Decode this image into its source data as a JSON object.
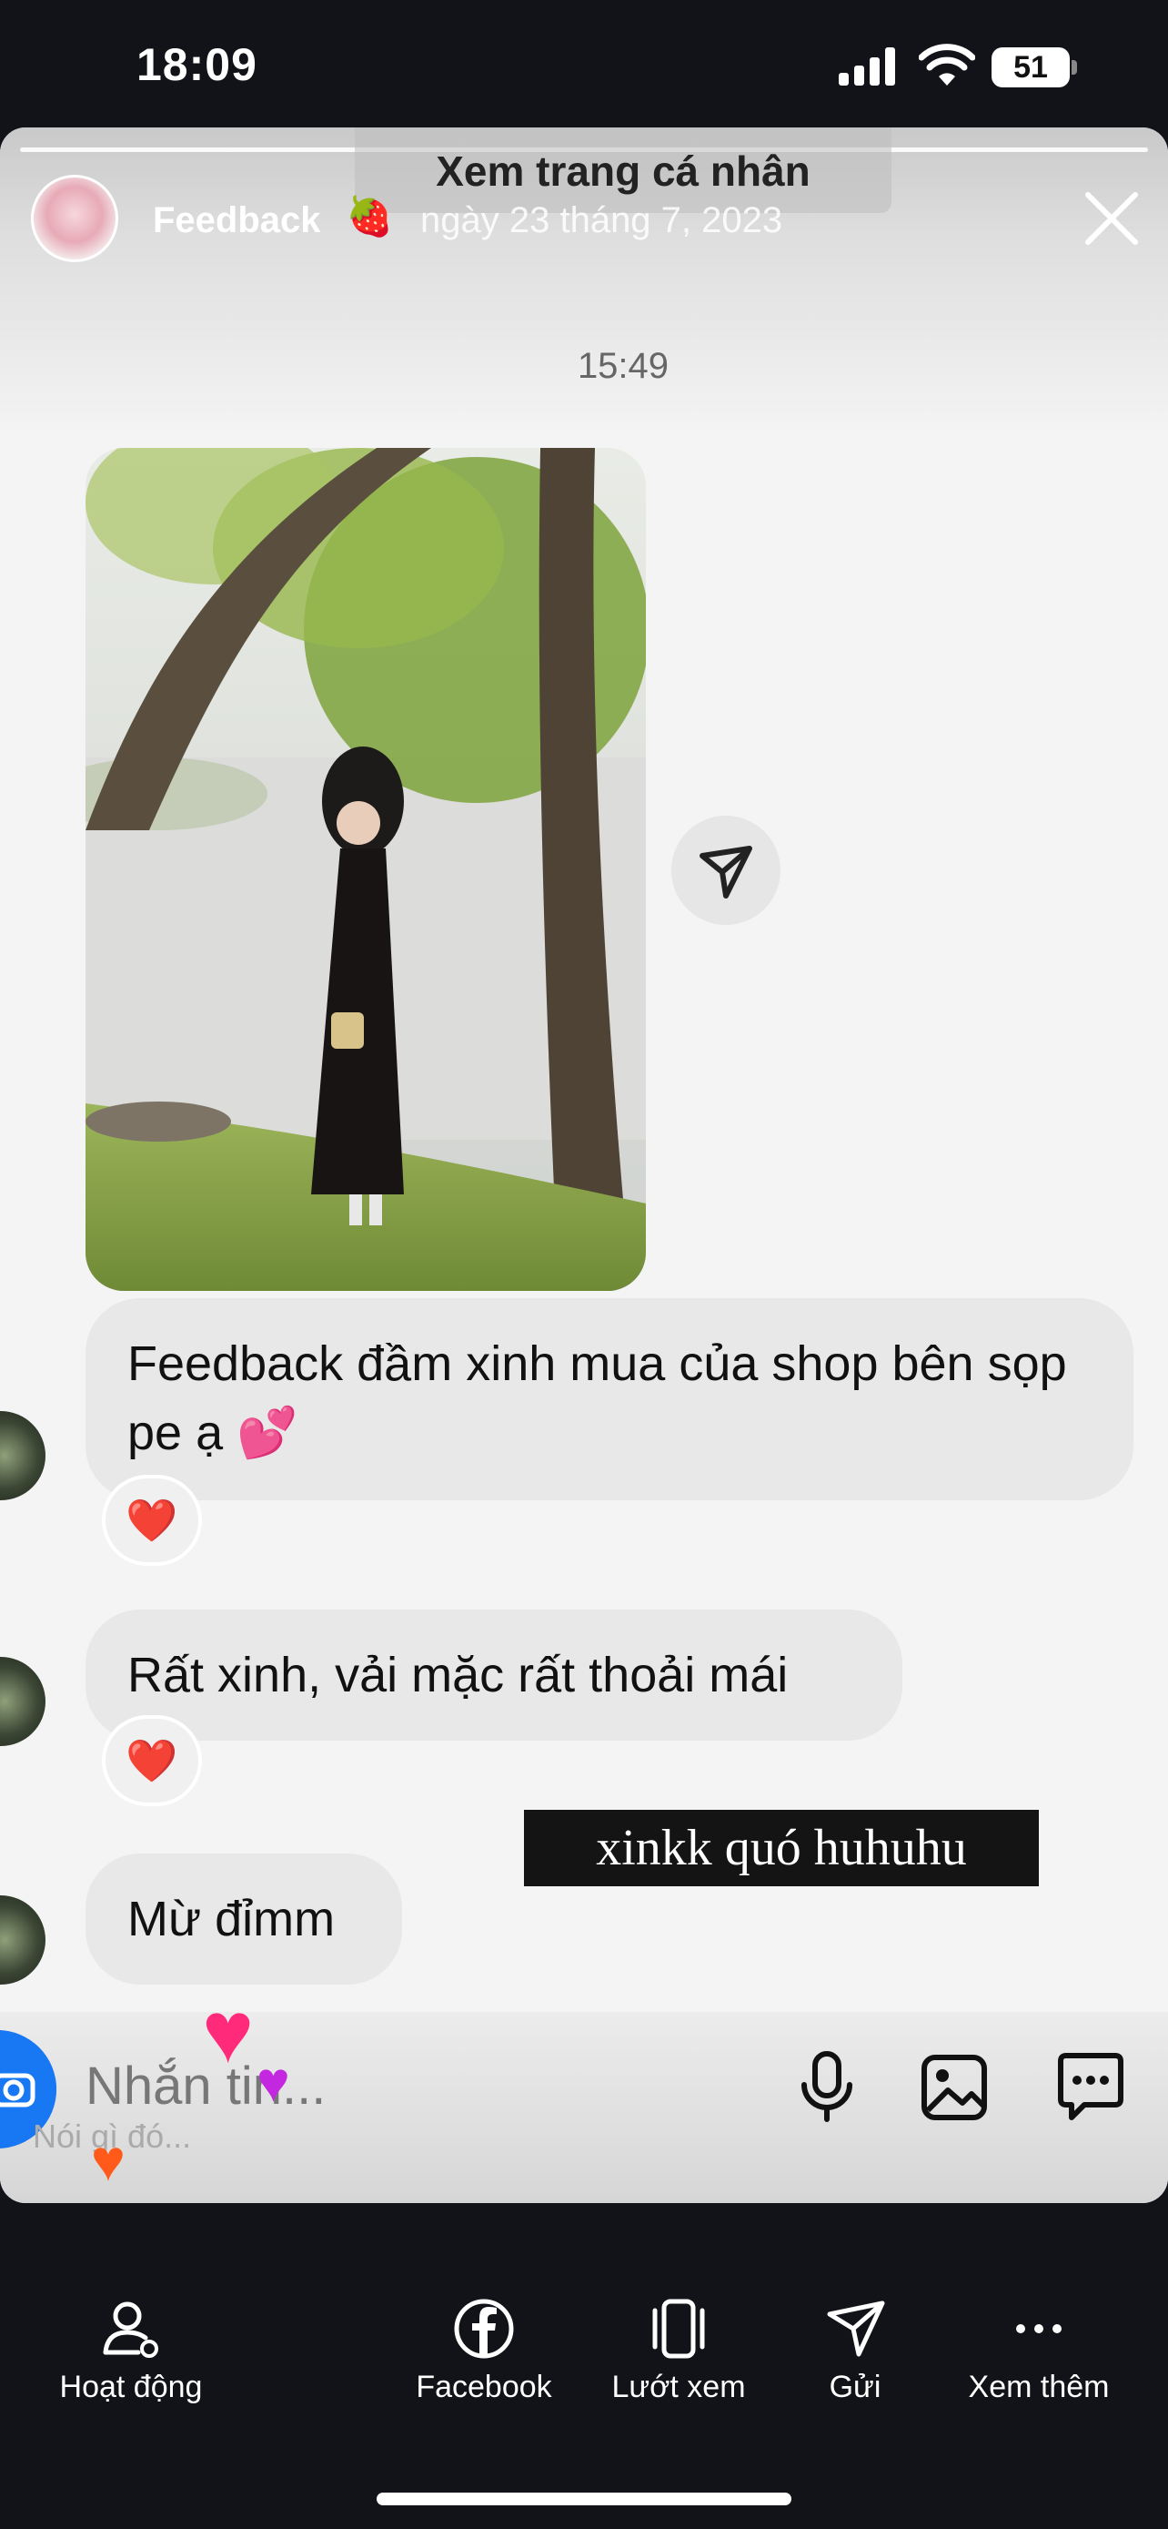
{
  "status_bar": {
    "time": "18:09",
    "battery": "51"
  },
  "story": {
    "view_profile": "Xem trang cá nhân",
    "username": "Feedback",
    "username_emoji": "🍓",
    "date": "ngày 23 tháng 7, 2023"
  },
  "chat": {
    "timestamp": "15:49",
    "messages": [
      {
        "text": "Feedback đầm xinh mua của shop bên sọp pe ạ 💕",
        "reaction": "❤️"
      },
      {
        "text": "Rất xinh, vải mặc rất thoải mái",
        "reaction": "❤️"
      },
      {
        "text": "Mừ đỉmm"
      }
    ]
  },
  "overlay_caption": "xinkk quó huhuhu",
  "composer": {
    "placeholder": "Nhắn tin...",
    "sub_placeholder": "Nói gì đó..."
  },
  "bottom_nav": [
    {
      "label": "Hoạt động",
      "icon": "activity-icon"
    },
    {
      "label": "Facebook",
      "icon": "facebook-icon"
    },
    {
      "label": "Lướt xem",
      "icon": "browse-icon"
    },
    {
      "label": "Gửi",
      "icon": "send-icon"
    },
    {
      "label": "Xem thêm",
      "icon": "more-icon"
    }
  ],
  "colors": {
    "background": "#111318",
    "card": "#f4f4f4",
    "bubble": "#e8e8e8",
    "camera": "#1877f2"
  }
}
